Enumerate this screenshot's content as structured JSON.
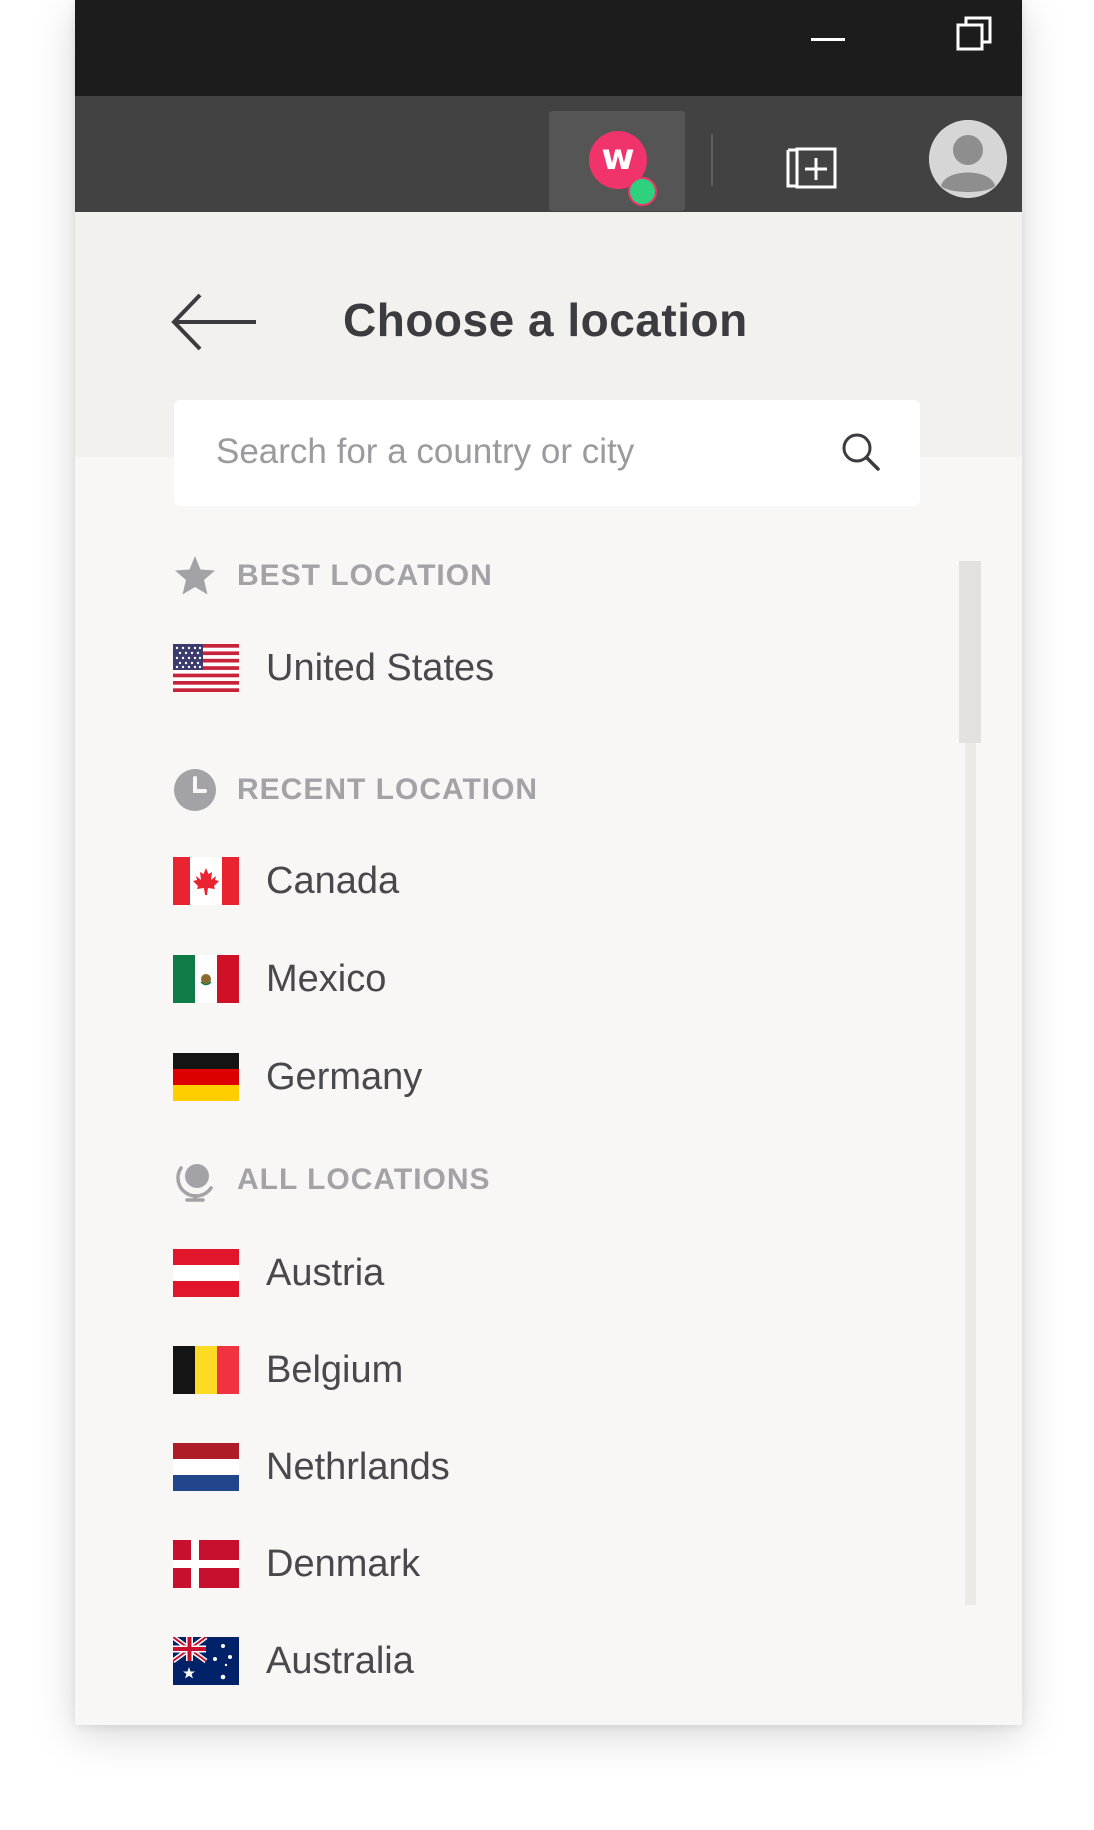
{
  "window": {
    "minimize_label": "Minimize",
    "restore_label": "Restore"
  },
  "toolbar": {
    "extension_letter": "w",
    "extension_status_color": "#2ed27e",
    "extension_brand_color": "#f0346b"
  },
  "panel": {
    "title": "Choose a location",
    "search": {
      "placeholder": "Search for a country or city",
      "value": ""
    },
    "sections": {
      "best": {
        "label": "BEST LOCATION",
        "icon": "star-icon"
      },
      "recent": {
        "label": "RECENT LOCATION",
        "icon": "clock-icon"
      },
      "all": {
        "label": "ALL LOCATIONS",
        "icon": "globe-icon"
      }
    },
    "best_locations": [
      {
        "name": "United States",
        "flag": "us-flag-icon"
      }
    ],
    "recent_locations": [
      {
        "name": "Canada",
        "flag": "canada-flag-icon"
      },
      {
        "name": "Mexico",
        "flag": "mexico-flag-icon"
      },
      {
        "name": "Germany",
        "flag": "germany-flag-icon"
      }
    ],
    "all_locations": [
      {
        "name": "Austria",
        "flag": "austria-flag-icon"
      },
      {
        "name": "Belgium",
        "flag": "belgium-flag-icon"
      },
      {
        "name": "Nethrlands",
        "flag": "netherlands-flag-icon"
      },
      {
        "name": "Denmark",
        "flag": "denmark-flag-icon"
      },
      {
        "name": "Australia",
        "flag": "australia-flag-icon"
      }
    ]
  }
}
